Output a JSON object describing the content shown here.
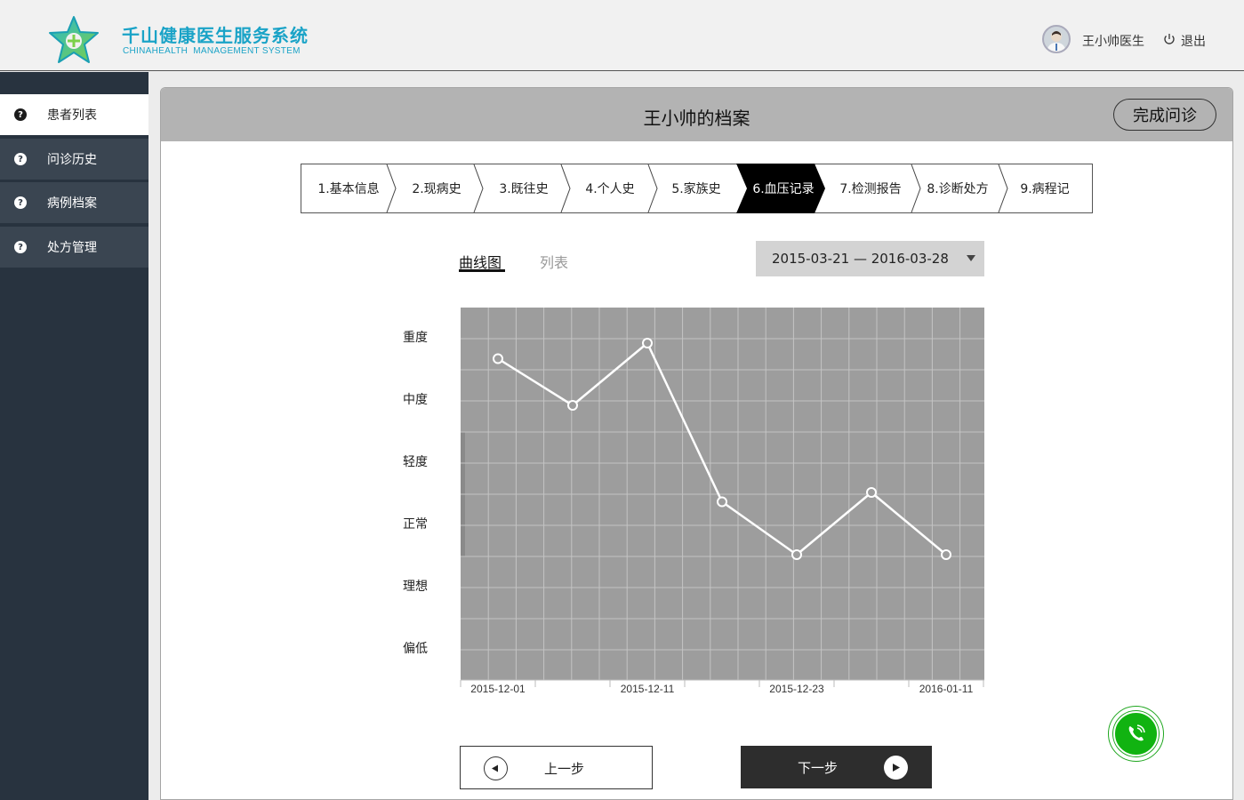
{
  "header": {
    "brand_title": "千山健康医生服务系统",
    "brand_subtitle": "CHINAHEALTH  MANAGEMENT SYSTEM",
    "user_name": "王小帅医生",
    "logout_label": "退出",
    "brand_color": "#1aa3c7"
  },
  "sidebar": {
    "items": [
      {
        "label": "患者列表",
        "active": true
      },
      {
        "label": "问诊历史",
        "active": false
      },
      {
        "label": "病例档案",
        "active": false
      },
      {
        "label": "处方管理",
        "active": false
      }
    ]
  },
  "panel": {
    "title": "王小帅的档案",
    "finish_button": "完成问诊"
  },
  "steps": [
    {
      "label": "1.基本信息"
    },
    {
      "label": "2.现病史"
    },
    {
      "label": "3.既往史"
    },
    {
      "label": "4.个人史"
    },
    {
      "label": "5.家族史"
    },
    {
      "label": "6.血压记录",
      "active": true
    },
    {
      "label": "7.检测报告"
    },
    {
      "label": "8.诊断处方"
    },
    {
      "label": "9.病程记"
    }
  ],
  "view_tabs": {
    "curve": "曲线图",
    "list": "列表"
  },
  "date_range": "2015-03-21 — 2016-03-28",
  "chart_data": {
    "type": "line",
    "y_categories": [
      "偏低",
      "理想",
      "正常",
      "轻度",
      "中度",
      "重度"
    ],
    "x_tick_labels": [
      "2015-12-01",
      "2015-12-11",
      "2015-12-23",
      "2016-01-11"
    ],
    "points": [
      {
        "x_index": 0,
        "y": 4.65
      },
      {
        "x_index": 1,
        "y": 3.9
      },
      {
        "x_index": 2,
        "y": 4.9
      },
      {
        "x_index": 3,
        "y": 2.35
      },
      {
        "x_index": 4,
        "y": 1.5
      },
      {
        "x_index": 5,
        "y": 2.5
      },
      {
        "x_index": 6,
        "y": 1.5
      }
    ],
    "grid": true,
    "background_color": "#9d9d9d",
    "line_color": "#ffffff"
  },
  "nav": {
    "prev_label": "上一步",
    "next_label": "下一步"
  },
  "call_button": {
    "icon": "phone-icon",
    "color": "#11b311"
  }
}
